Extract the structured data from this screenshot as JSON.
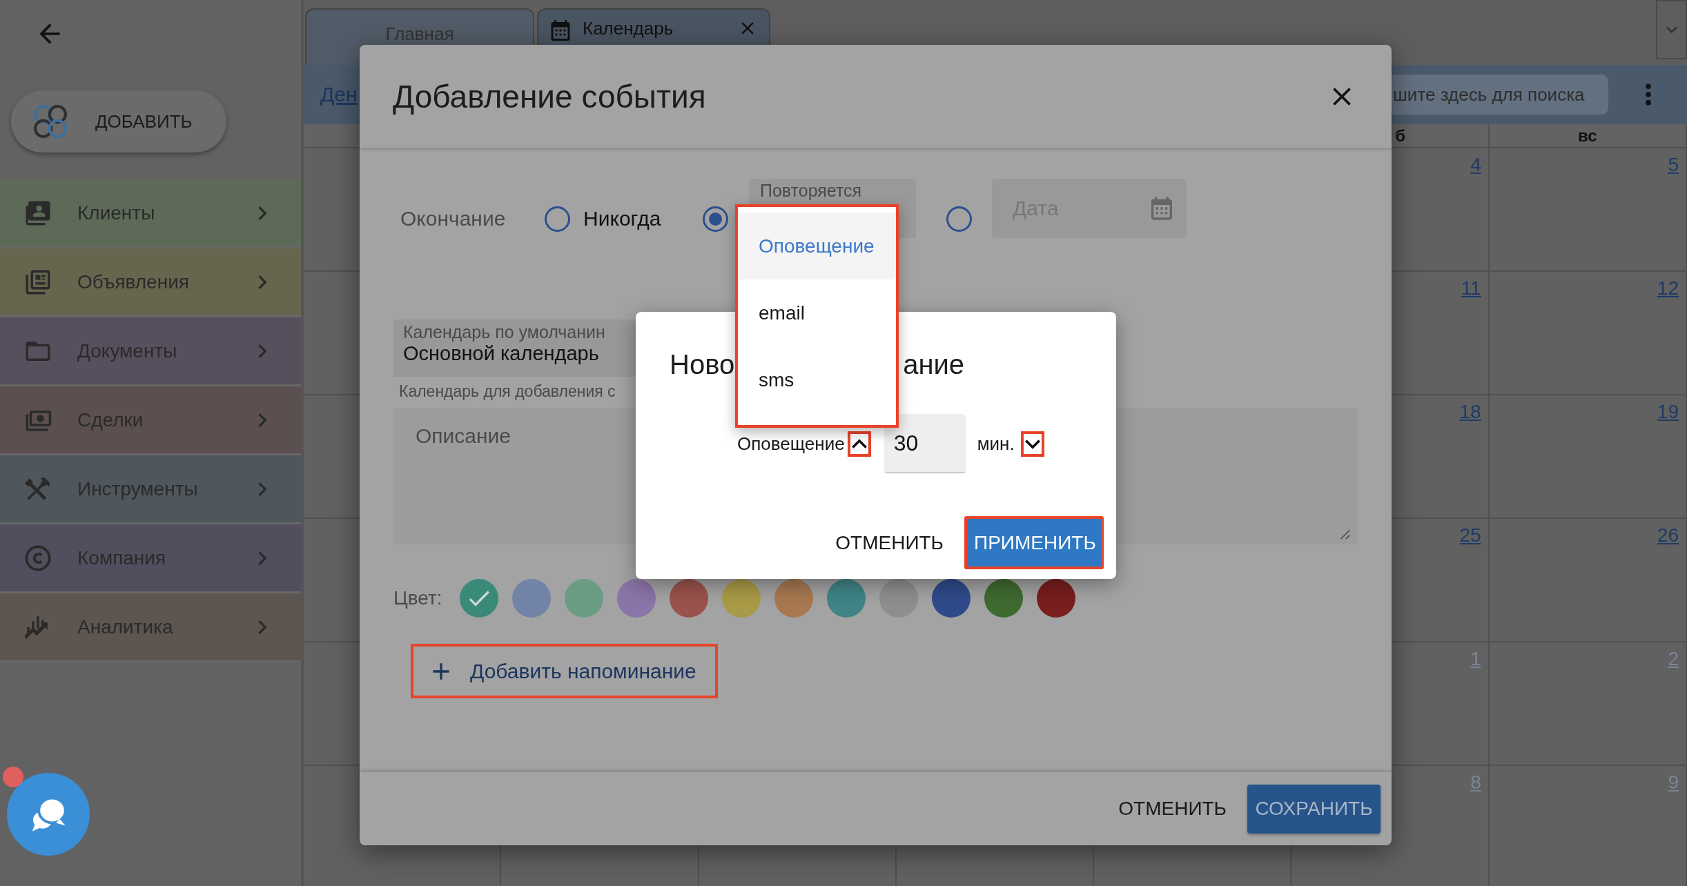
{
  "add_button": {
    "label": "ДОБАВИТЬ"
  },
  "sidebar": {
    "items": [
      {
        "label": "Клиенты",
        "color": "#5d6a57"
      },
      {
        "label": "Объявления",
        "color": "#66664f"
      },
      {
        "label": "Документы",
        "color": "#56505e"
      },
      {
        "label": "Сделки",
        "color": "#5c4f4f"
      },
      {
        "label": "Инструменты",
        "color": "#4f565c"
      },
      {
        "label": "Компания",
        "color": "#514f5e"
      },
      {
        "label": "Аналитика",
        "color": "#5d5550"
      }
    ]
  },
  "tabs": [
    {
      "label": "Главная",
      "selected": false
    },
    {
      "label": "Календарь",
      "selected": true
    }
  ],
  "toolbar": {
    "view_link": "Ден",
    "search": {
      "placeholder": "шите здесь для поиска"
    }
  },
  "calendar": {
    "headers": [
      "б",
      "вс"
    ],
    "weeks": [
      {
        "days": [
          {
            "number": "4",
            "other_month": false
          },
          {
            "number": "5",
            "other_month": false
          }
        ]
      },
      {
        "days": [
          {
            "number": "11",
            "other_month": false
          },
          {
            "number": "12",
            "other_month": false
          }
        ]
      },
      {
        "days": [
          {
            "number": "18",
            "other_month": false
          },
          {
            "number": "19",
            "other_month": false
          }
        ]
      },
      {
        "days": [
          {
            "number": "25",
            "other_month": false
          },
          {
            "number": "26",
            "other_month": false
          }
        ]
      },
      {
        "days": [
          {
            "number": "1",
            "other_month": true
          },
          {
            "number": "2",
            "other_month": true
          }
        ]
      },
      {
        "days": [
          {
            "number": "8",
            "other_month": true
          },
          {
            "number": "9",
            "other_month": true
          }
        ]
      }
    ]
  },
  "event_dialog": {
    "title": "Добавление события",
    "end": {
      "label": "Окончание",
      "options": [
        {
          "kind": "never",
          "label": "Никогда",
          "selected": false
        },
        {
          "kind": "repeat",
          "field_label": "Повторяется",
          "selected": true
        },
        {
          "kind": "date",
          "placeholder": "Дата",
          "selected": false
        }
      ]
    },
    "calendar_field": {
      "label": "Календарь по умолчанин",
      "value": "Основной календарь",
      "helper": "Календарь для добавления с"
    },
    "description": {
      "placeholder": "Описание"
    },
    "colors": {
      "label": "Цвет:",
      "swatches": [
        {
          "color": "#3a8a7a",
          "selected": true
        },
        {
          "color": "#7283a8",
          "selected": false
        },
        {
          "color": "#6a9c84",
          "selected": false
        },
        {
          "color": "#8b74a8",
          "selected": false
        },
        {
          "color": "#9a524c",
          "selected": false
        },
        {
          "color": "#a89a46",
          "selected": false
        },
        {
          "color": "#a87850",
          "selected": false
        },
        {
          "color": "#3f8486",
          "selected": false
        },
        {
          "color": "#8e8e8e",
          "selected": false
        },
        {
          "color": "#2f4a8a",
          "selected": false
        },
        {
          "color": "#3f6a30",
          "selected": false
        },
        {
          "color": "#7a1e1e",
          "selected": false
        }
      ]
    },
    "add_reminder": {
      "label": "Добавить напоминание",
      "highlighted": true
    },
    "buttons": [
      {
        "label": "ОТМЕНИТЬ",
        "primary": false
      },
      {
        "label": "СОХРАНИТЬ",
        "primary": true
      }
    ]
  },
  "reminder_dialog": {
    "title_start": "Ново",
    "title_end": "ание",
    "type_label": "Оповещение",
    "type_toggle": {
      "expanded": true,
      "highlighted": true
    },
    "amount": "30",
    "unit": "мин.",
    "unit_toggle": {
      "expanded": false,
      "highlighted": true
    },
    "buttons": [
      {
        "label": "ОТМЕНИТЬ",
        "primary": false,
        "highlighted": false
      },
      {
        "label": "ПРИМЕНИТЬ",
        "primary": true,
        "highlighted": true
      }
    ]
  },
  "type_menu": {
    "highlighted": true,
    "items": [
      {
        "label": "Оповещение",
        "selected": true
      },
      {
        "label": "email",
        "selected": false
      },
      {
        "label": "sms",
        "selected": false
      }
    ]
  },
  "chat": {
    "unread": true
  }
}
